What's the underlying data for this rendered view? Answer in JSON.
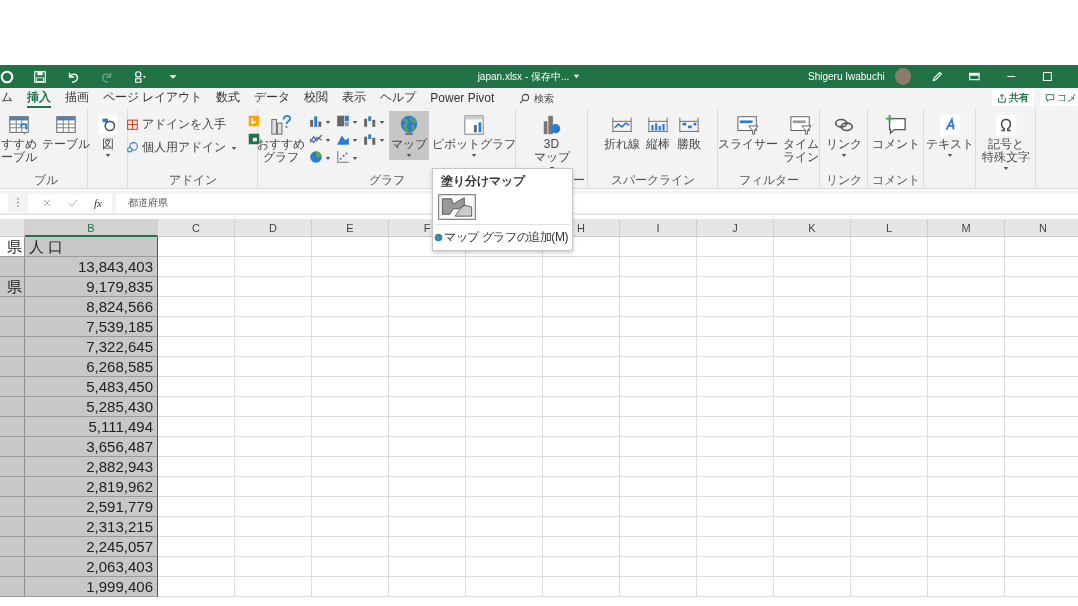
{
  "title_bar": {
    "file": "japan.xlsx - 保存中...",
    "user": "Shigeru Iwabuchi"
  },
  "quick_access": [
    {
      "disabled": false
    },
    {
      "disabled": false
    },
    {
      "disabled": false
    },
    {
      "disabled": true
    },
    {
      "disabled": false
    },
    {
      "disabled": false
    }
  ],
  "tabs": [
    {
      "label": "ム",
      "selected": false
    },
    {
      "label": "挿入",
      "selected": true
    },
    {
      "label": "描画",
      "selected": false
    },
    {
      "label": "ページ レイアウト",
      "selected": false
    },
    {
      "label": "数式",
      "selected": false
    },
    {
      "label": "データ",
      "selected": false
    },
    {
      "label": "校閲",
      "selected": false
    },
    {
      "label": "表示",
      "selected": false
    },
    {
      "label": "ヘルプ",
      "selected": false
    },
    {
      "label": "Power Pivot",
      "selected": false
    }
  ],
  "search": {
    "placeholder": "検索"
  },
  "share_button": "共有",
  "comments_button": "コメ",
  "ribbon_groups": [
    {
      "label": "ブル",
      "columns": [
        [
          {
            "kind": "large",
            "lines": [
              "すすめ",
              "ーブル"
            ],
            "menu": false,
            "pressed": false
          }
        ],
        [
          {
            "kind": "large",
            "label": "テーブル",
            "menu": false,
            "pressed": false
          }
        ]
      ]
    },
    {
      "columns": [
        [
          {
            "kind": "large",
            "label": "図",
            "menu": true,
            "pressed": false
          }
        ]
      ]
    },
    {
      "label": "アドイン",
      "columns": [
        [
          {
            "kind": "small",
            "label": "アドインを入手",
            "menu": false,
            "pressed": false
          },
          {
            "kind": "small",
            "label": "個人用アドイン",
            "menu": true,
            "pressed": false
          }
        ],
        [
          {
            "kind": "icon",
            "menu": false,
            "pressed": false
          },
          {
            "kind": "icon",
            "menu": false,
            "pressed": false
          }
        ]
      ]
    },
    {
      "label": "グラフ",
      "columns": [
        [
          {
            "kind": "large",
            "lines": [
              "おすすめ",
              "グラフ"
            ],
            "menu": false,
            "pressed": false
          }
        ],
        [
          {
            "kind": "icon",
            "menu": true,
            "pressed": false
          },
          {
            "kind": "icon",
            "menu": true,
            "pressed": false
          },
          {
            "kind": "icon",
            "menu": true,
            "pressed": false
          }
        ],
        [
          {
            "kind": "icon",
            "menu": true,
            "pressed": false
          },
          {
            "kind": "icon",
            "menu": true,
            "pressed": false
          },
          {
            "kind": "icon",
            "menu": true,
            "pressed": false
          }
        ],
        [
          {
            "kind": "icon",
            "menu": true,
            "pressed": false
          },
          {
            "kind": "icon",
            "menu": true,
            "pressed": false
          }
        ],
        [
          {
            "kind": "large",
            "label": "マップ",
            "menu": true,
            "pressed": true
          }
        ],
        [
          {
            "kind": "large",
            "label": "ピボットグラフ",
            "menu": true,
            "pressed": false
          }
        ]
      ]
    },
    {
      "label": "ー",
      "columns": [
        [
          {
            "kind": "large",
            "lines": [
              "3D",
              "マップ"
            ],
            "menu": true,
            "pressed": false
          }
        ]
      ]
    },
    {
      "label": "スパークライン",
      "columns": [
        [
          {
            "kind": "large",
            "label": "折れ線",
            "menu": false,
            "pressed": false
          }
        ],
        [
          {
            "kind": "large",
            "label": "縦棒",
            "menu": false,
            "pressed": false
          }
        ],
        [
          {
            "kind": "large",
            "label": "勝敗",
            "menu": false,
            "pressed": false
          }
        ]
      ]
    },
    {
      "label": "フィルター",
      "columns": [
        [
          {
            "kind": "large",
            "label": "スライサー",
            "menu": false,
            "pressed": false
          }
        ],
        [
          {
            "kind": "large",
            "lines": [
              "タイム",
              "ライン"
            ],
            "menu": false,
            "pressed": false
          }
        ]
      ]
    },
    {
      "label": "リンク",
      "columns": [
        [
          {
            "kind": "large",
            "label": "リンク",
            "menu": true,
            "pressed": false
          }
        ]
      ]
    },
    {
      "label": "コメント",
      "columns": [
        [
          {
            "kind": "large",
            "label": "コメント",
            "menu": false,
            "pressed": false
          }
        ]
      ]
    },
    {
      "columns": [
        [
          {
            "kind": "large",
            "label": "テキスト",
            "menu": true,
            "pressed": false
          }
        ]
      ]
    },
    {
      "columns": [
        [
          {
            "kind": "large",
            "lines": [
              "記号と",
              "特殊文字"
            ],
            "menu": true,
            "pressed": false
          }
        ]
      ]
    }
  ],
  "map_menu": {
    "header": "塗り分けマップ",
    "item": "マップ グラフの追加(M)"
  },
  "formula_bar": {
    "function_label": "fx",
    "value": "都道府県"
  },
  "columns": [
    {
      "label": "B",
      "selected": true
    },
    {
      "label": "C",
      "selected": false
    },
    {
      "label": "D",
      "selected": false
    },
    {
      "label": "E",
      "selected": false
    },
    {
      "label": "F",
      "selected": false
    },
    {
      "label": "H",
      "selected": false
    },
    {
      "label": "I",
      "selected": false
    },
    {
      "label": "J",
      "selected": false
    },
    {
      "label": "K",
      "selected": false
    },
    {
      "label": "L",
      "selected": false
    },
    {
      "label": "M",
      "selected": false
    },
    {
      "label": "N",
      "selected": false
    }
  ],
  "rows": [
    {
      "a": "県",
      "b": "人 口",
      "active": true
    },
    {
      "b": "13,843,403",
      "active": false
    },
    {
      "a": "県",
      "b": "9,179,835",
      "active": false
    },
    {
      "b": "8,824,566",
      "active": false
    },
    {
      "b": "7,539,185",
      "active": false
    },
    {
      "b": "7,322,645",
      "active": false
    },
    {
      "b": "6,268,585",
      "active": false
    },
    {
      "b": "5,483,450",
      "active": false
    },
    {
      "b": "5,285,430",
      "active": false
    },
    {
      "b": "5,111,494",
      "active": false
    },
    {
      "b": "3,656,487",
      "active": false
    },
    {
      "b": "2,882,943",
      "active": false
    },
    {
      "b": "2,819,962",
      "active": false
    },
    {
      "b": "2,591,779",
      "active": false
    },
    {
      "b": "2,313,215",
      "active": false
    },
    {
      "b": "2,245,057",
      "active": false
    },
    {
      "b": "2,063,403",
      "active": false
    },
    {
      "b": "1,999,406",
      "active": false
    }
  ]
}
